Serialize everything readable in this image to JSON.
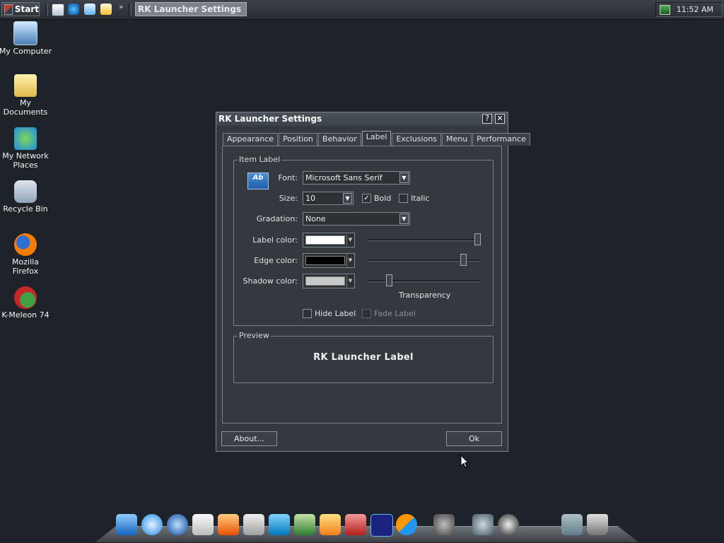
{
  "taskbar": {
    "start_label": "Start",
    "more_label": "»",
    "active_task": "RK Launcher Settings",
    "clock": "11:52 AM",
    "quick_launch": [
      "show-desktop-icon",
      "internet-explorer-icon",
      "outlook-express-icon",
      "search-icon"
    ]
  },
  "desktop": {
    "icons": [
      {
        "name": "my-computer-icon",
        "label": "My Computer"
      },
      {
        "name": "my-documents-icon",
        "label": "My Documents"
      },
      {
        "name": "my-network-places-icon",
        "label": "My Network Places"
      },
      {
        "name": "recycle-bin-icon",
        "label": "Recycle Bin"
      },
      {
        "name": "mozilla-firefox-icon",
        "label": "Mozilla Firefox"
      },
      {
        "name": "k-meleon-icon",
        "label": "K-Meleon 74"
      }
    ]
  },
  "dialog": {
    "title": "RK Launcher Settings",
    "help_label": "?",
    "close_label": "✕",
    "tabs": [
      "Appearance",
      "Position",
      "Behavior",
      "Label",
      "Exclusions",
      "Menu",
      "Performance"
    ],
    "active_tab": "Label",
    "item_label": {
      "group_title": "Item Label",
      "icon_text": "Ab",
      "font_label": "Font:",
      "font_value": "Microsoft Sans Serif",
      "size_label": "Size:",
      "size_value": "10",
      "bold_label": "Bold",
      "bold_checked": true,
      "italic_label": "Italic",
      "italic_checked": false,
      "gradation_label": "Gradation:",
      "gradation_value": "None",
      "label_color_label": "Label color:",
      "label_color": "#ffffff",
      "label_color_slider": 1.0,
      "edge_color_label": "Edge color:",
      "edge_color": "#000000",
      "edge_color_slider": 0.87,
      "shadow_color_label": "Shadow color:",
      "shadow_color": "#c8c8c8",
      "shadow_color_slider": 0.17,
      "transparency_label": "Transparency",
      "hide_label": "Hide Label",
      "hide_checked": false,
      "fade_label": "Fade Label",
      "fade_checked": false
    },
    "preview": {
      "group_title": "Preview",
      "text": "RK Launcher Label"
    },
    "about_button": "About...",
    "ok_button": "Ok"
  },
  "dock": {
    "icons": [
      "finder-icon",
      "safari-icon",
      "quicktime-icon",
      "notes-icon",
      "applications-icon",
      "calculator-icon",
      "word-icon",
      "excel-icon",
      "powerpoint-icon",
      "access-icon",
      "photoshop-icon",
      "messenger-icon",
      "system-preferences-icon",
      "settings-icon",
      "shutdown-icon",
      "stack-icon",
      "trash-icon"
    ]
  }
}
